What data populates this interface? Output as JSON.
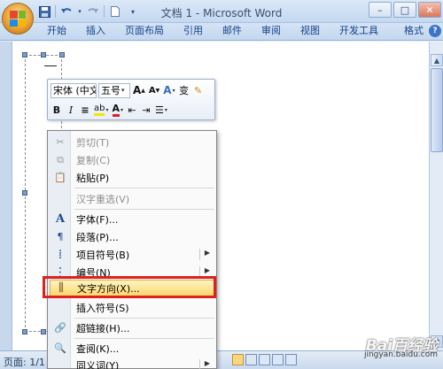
{
  "window": {
    "title": "文档 1 - Microsoft Word",
    "controls": {
      "minimize": "–",
      "maximize": "□",
      "close": "✕"
    }
  },
  "qat": {
    "items": [
      {
        "name": "save-icon",
        "glyph": "💾"
      },
      {
        "name": "undo-icon",
        "glyph": "↶"
      },
      {
        "name": "redo-icon",
        "glyph": "↷"
      },
      {
        "name": "new-document-icon",
        "glyph": "▯"
      },
      {
        "name": "customize-qat-icon",
        "glyph": "▾"
      }
    ]
  },
  "ribbon": {
    "tabs": [
      "开始",
      "插入",
      "页面布局",
      "引用",
      "邮件",
      "审阅",
      "视图",
      "开发工具",
      "格式"
    ],
    "minimize_glyph": "▲",
    "help_glyph": "?"
  },
  "mini_toolbar": {
    "font_name": "宋体 (中文",
    "font_size": "五号",
    "grow_font": "A",
    "shrink_font": "A",
    "styles": "A",
    "phonetic": "变",
    "format_painter": "✎",
    "bold": "B",
    "italic": "I",
    "center": "≡",
    "highlight": "ab",
    "font_color": "A",
    "decrease_indent": "⇤",
    "increase_indent": "⇥",
    "bullets": "☰"
  },
  "context_menu": {
    "items": [
      {
        "label": "剪切(T)",
        "icon": "✂",
        "disabled": true
      },
      {
        "label": "复制(C)",
        "icon": "⧉",
        "disabled": true
      },
      {
        "label": "粘贴(P)",
        "icon": "📋",
        "disabled": false
      },
      {
        "label": "汉字重选(V)",
        "icon": "",
        "disabled": true
      },
      {
        "label": "字体(F)...",
        "icon": "A",
        "disabled": false
      },
      {
        "label": "段落(P)...",
        "icon": "¶",
        "disabled": false
      },
      {
        "label": "项目符号(B)",
        "icon": "⁞",
        "disabled": false,
        "submenu": true
      },
      {
        "label": "编号(N)",
        "icon": "⋮",
        "disabled": false,
        "submenu": true
      },
      {
        "label": "文字方向(X)...",
        "icon": "⫼",
        "disabled": false,
        "highlighted": true
      },
      {
        "label": "插入符号(S)",
        "icon": "",
        "disabled": false
      },
      {
        "label": "超链接(H)...",
        "icon": "🔗",
        "disabled": false
      },
      {
        "label": "查阅(K)...",
        "icon": "🔍",
        "disabled": false
      },
      {
        "label": "同义词(Y)",
        "icon": "",
        "disabled": false,
        "submenu": true
      }
    ]
  },
  "status_bar": {
    "page": "页面: 1/1"
  },
  "watermark": {
    "logo": "Bai百经验",
    "url": "jingyan.baidu.com"
  },
  "colors": {
    "highlight_red": "#e01f1f",
    "menu_highlight": "#fcd96e",
    "ribbon_blue": "#c3d7ef"
  }
}
